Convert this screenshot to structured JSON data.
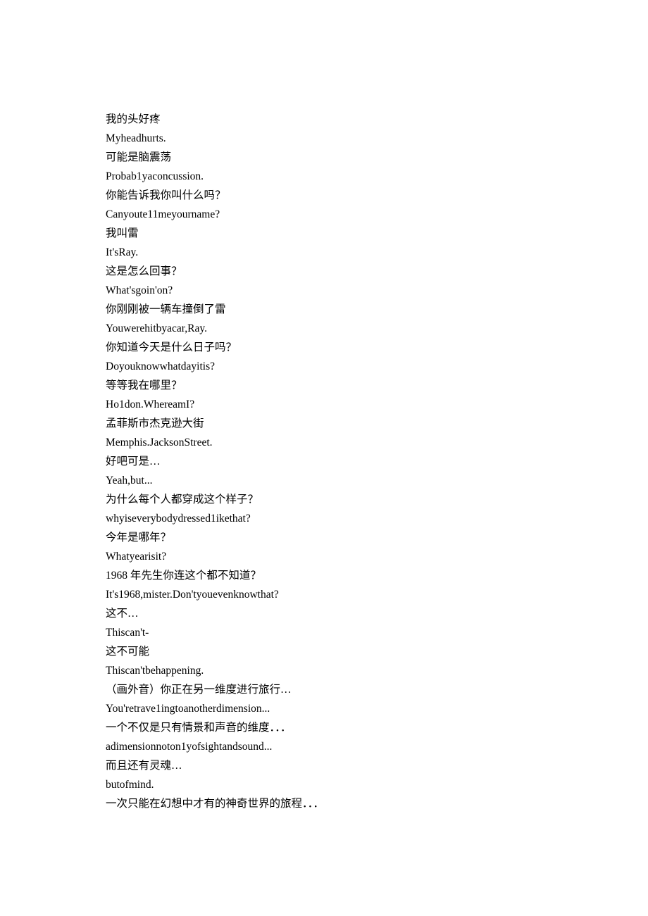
{
  "lines": [
    "我的头好疼",
    "Myheadhurts.",
    "可能是脑震荡",
    "Probab1yaconcussion.",
    "你能告诉我你叫什么吗？",
    "Canyoute11meyourname?",
    "我叫雷",
    "It'sRay.",
    "这是怎么回事？",
    "What'sgoin'on?",
    "你刚刚被一辆车撞倒了雷",
    "Youwerehitbyacar,Ray.",
    "你知道今天是什么日子吗？",
    "Doyouknowwhatdayitis?",
    "等等我在哪里？",
    "Ho1don.WhereamI?",
    "孟菲斯市杰克逊大街",
    "Memphis.JacksonStreet.",
    "好吧可是…",
    "Yeah,but...",
    "为什么每个人都穿成这个样子？",
    "whyiseverybodydressed1ikethat?",
    "今年是哪年？",
    "Whatyearisit?",
    "1968 年先生你连这个都不知道？",
    "It's1968,mister.Don'tyouevenknowthat?",
    "这不…",
    "Thiscan't-",
    "这不可能",
    "Thiscan'tbehappening.",
    "（画外音）你正在另一维度进行旅行…",
    "You'retrave1ingtoanotherdimension...",
    "一个不仅是只有情景和声音的维度．．．",
    "adimensionnoton1yofsightandsound...",
    "而且还有灵魂…",
    "butofmind.",
    "一次只能在幻想中才有的神奇世界的旅程．．．"
  ]
}
